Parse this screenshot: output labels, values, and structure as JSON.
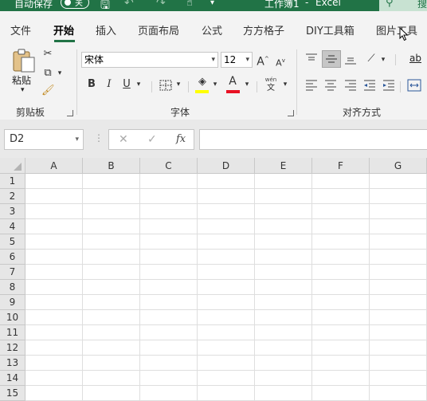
{
  "title_bar": {
    "autosave_label": "自动保存",
    "autosave_state": "关",
    "doc_title": "工作簿1",
    "app_name": "Excel",
    "search_label": "搜"
  },
  "tabs": [
    {
      "label": "文件",
      "active": false
    },
    {
      "label": "开始",
      "active": true
    },
    {
      "label": "插入",
      "active": false
    },
    {
      "label": "页面布局",
      "active": false
    },
    {
      "label": "公式",
      "active": false
    },
    {
      "label": "方方格子",
      "active": false
    },
    {
      "label": "DIY工具箱",
      "active": false
    },
    {
      "label": "图片工具",
      "active": false
    }
  ],
  "ribbon": {
    "clipboard": {
      "group_label": "剪贴板",
      "paste_label": "粘贴"
    },
    "font": {
      "group_label": "字体",
      "font_name": "宋体",
      "font_size": "12",
      "grow_label": "A",
      "shrink_label": "A",
      "bold_label": "B",
      "italic_label": "I",
      "underline_label": "U",
      "font_color_label": "A",
      "phonetic_top": "wén",
      "phonetic_bottom": "文",
      "highlight_color": "#ffff00",
      "font_color": "#e81123"
    },
    "alignment": {
      "group_label": "对齐方式"
    },
    "more": {
      "label": "ab"
    }
  },
  "formula_bar": {
    "name_box_value": "D2",
    "cancel_symbol": "✕",
    "enter_symbol": "✓",
    "fx_label": "fx",
    "formula_value": ""
  },
  "sheet": {
    "columns": [
      "A",
      "B",
      "C",
      "D",
      "E",
      "F",
      "G"
    ],
    "rows": [
      "1",
      "2",
      "3",
      "4",
      "5",
      "6",
      "7",
      "8",
      "9",
      "10",
      "11",
      "12",
      "13",
      "14",
      "15"
    ]
  },
  "colors": {
    "accent": "#217346",
    "ribbon_bg": "#f3f3f3"
  }
}
